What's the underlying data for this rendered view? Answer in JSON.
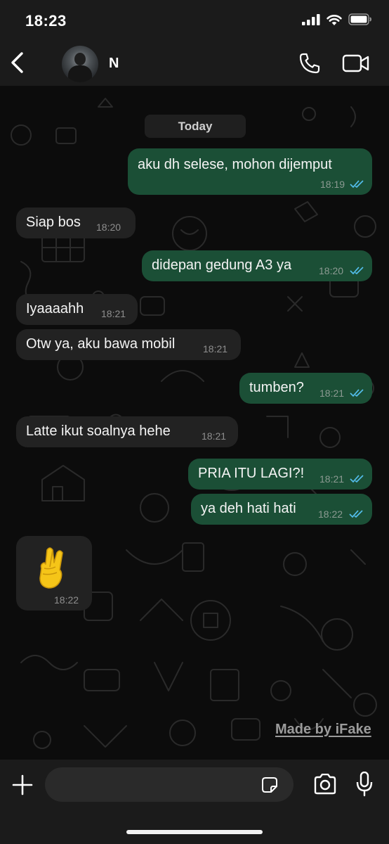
{
  "status_bar": {
    "time": "18:23"
  },
  "header": {
    "contact_name": "N"
  },
  "chat": {
    "date_label": "Today",
    "messages": [
      {
        "dir": "out",
        "text": "aku dh selese, mohon dijemput",
        "time": "18:19"
      },
      {
        "dir": "in",
        "text": "Siap bos",
        "time": "18:20"
      },
      {
        "dir": "out",
        "text": "didepan gedung A3 ya",
        "time": "18:20"
      },
      {
        "dir": "in",
        "text": "Iyaaaahh",
        "time": "18:21"
      },
      {
        "dir": "in",
        "text": "Otw ya, aku bawa mobil",
        "time": "18:21"
      },
      {
        "dir": "out",
        "text": "tumben?",
        "time": "18:21"
      },
      {
        "dir": "in",
        "text": "Latte ikut soalnya hehe",
        "time": "18:21"
      },
      {
        "dir": "out",
        "text": "PRIA ITU LAGI?!",
        "time": "18:21"
      },
      {
        "dir": "out",
        "text": "ya deh hati hati",
        "time": "18:22"
      },
      {
        "dir": "in",
        "emoji": "crossed-fingers",
        "time": "18:22"
      }
    ],
    "watermark": "Made by iFake"
  },
  "colors": {
    "outgoing_bubble": "#1b4f36",
    "incoming_bubble": "#222222",
    "read_ticks": "#53bdeb"
  }
}
